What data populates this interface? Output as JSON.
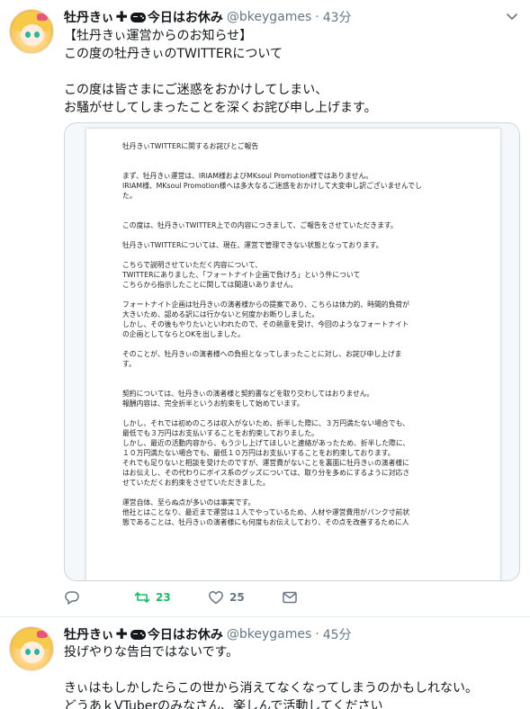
{
  "tweets": [
    {
      "user": {
        "name": "牡丹きぃ",
        "name_suffix": "今日はお休み",
        "handle": "@bkeygames",
        "time": "43分"
      },
      "text_lines": [
        "【牡丹きぃ運営からのお知らせ】",
        "この度の牡丹きぃのTWITTERについて",
        "",
        "この度は皆さまにご迷惑をおかけしてしまい、",
        "お騒がせしてしまったことを深くお詫び申し上げます。"
      ],
      "document_lines": [
        "牡丹きぃTWITTERに関するお詫びとご報告",
        "",
        "",
        "まず、牡丹きぃ運営は、IRIAM様およびMKsoul Promotion様ではありません。",
        "IRIAM様、MKsoul Promotion様へは多大なるご迷惑をおかけして大変申し訳ございませんでし",
        "た。",
        "",
        "",
        "この度は、牡丹きぃTWITTER上での内容につきまして、ご報告をさせていただきます。",
        "",
        "牡丹きぃTWITTERについては、現在、運営で管理できない状態となっております。",
        "",
        "こちらで説明させていただく内容について、",
        "TWITTERにありました、「フォートナイト企画で負けろ」という件について",
        "こちらから指示したことに関しては間違いありません。",
        "",
        "フォートナイト企画は牡丹きぃの演者様からの提案であり、こちらは体力的、時間的負荷が",
        "大きいため、認める訳には行かないと何度かお断りしました。",
        "しかし、その後もやりたいといわれたので、その熱意を受け、今回のようなフォートナイト",
        "の企画としてならとOKを出しました。",
        "",
        "そのことが、牡丹きぃの演者様への負担となってしまったことに対し、お詫び申し上げま",
        "す。",
        "",
        "",
        "契約については、牡丹きぃの演者様と契約書などを取り交わしてはおりません。",
        "報酬内容は、完全折半というお約束をして始めています。",
        "",
        "しかし、それでは初めのころは収入がないため、折半した際に、３万円満たない場合でも、",
        "最低でも３万円はお支払いすることをお約束しておりました。",
        "しかし、最近の活動内容から、もう少し上げてほしいと連絡があったため、折半した際に、",
        "１０万円満たない場合でも、最低１０万円はお支払いすることをお約束しております。",
        "それでも足りないと相談を受けたのですが、運営費がないことを裏面に牡丹きぃの演者様に",
        "はお伝えし、その代わりにボイス系のグッズについては、取り分を多めにするように対応さ",
        "せていただくお約束をさせていただきました。",
        "",
        "運営自体、至らぬ点が多いのは事実です。",
        "他社とはことなり、最近まで運営は１人でやっているため、人材や運営費用がパンク寸前状",
        "態であることは、牡丹きぃの演者様にも何度もお伝えしており、その点を改善するために人"
      ],
      "stats": {
        "replies": "",
        "retweets": "23",
        "likes": "25"
      }
    },
    {
      "user": {
        "name": "牡丹きぃ",
        "name_suffix": "今日はお休み",
        "handle": "@bkeygames",
        "time": "45分"
      },
      "text_lines": [
        "投げやりな告白ではないです。",
        "",
        "きぃはもしかしたらこの世から消えてなくなってしまうのかもしれない。",
        "どうあｋVTuberのみなさん、楽しんで活動してください"
      ]
    }
  ],
  "colors": {
    "retweet_green": "#17bf63",
    "muted_gray": "#657786",
    "text": "#14171a"
  },
  "icons": [
    "avatar",
    "cross-icon",
    "gamepad-icon",
    "caret-down-icon",
    "reply-icon",
    "retweet-icon",
    "like-icon",
    "dm-icon"
  ]
}
